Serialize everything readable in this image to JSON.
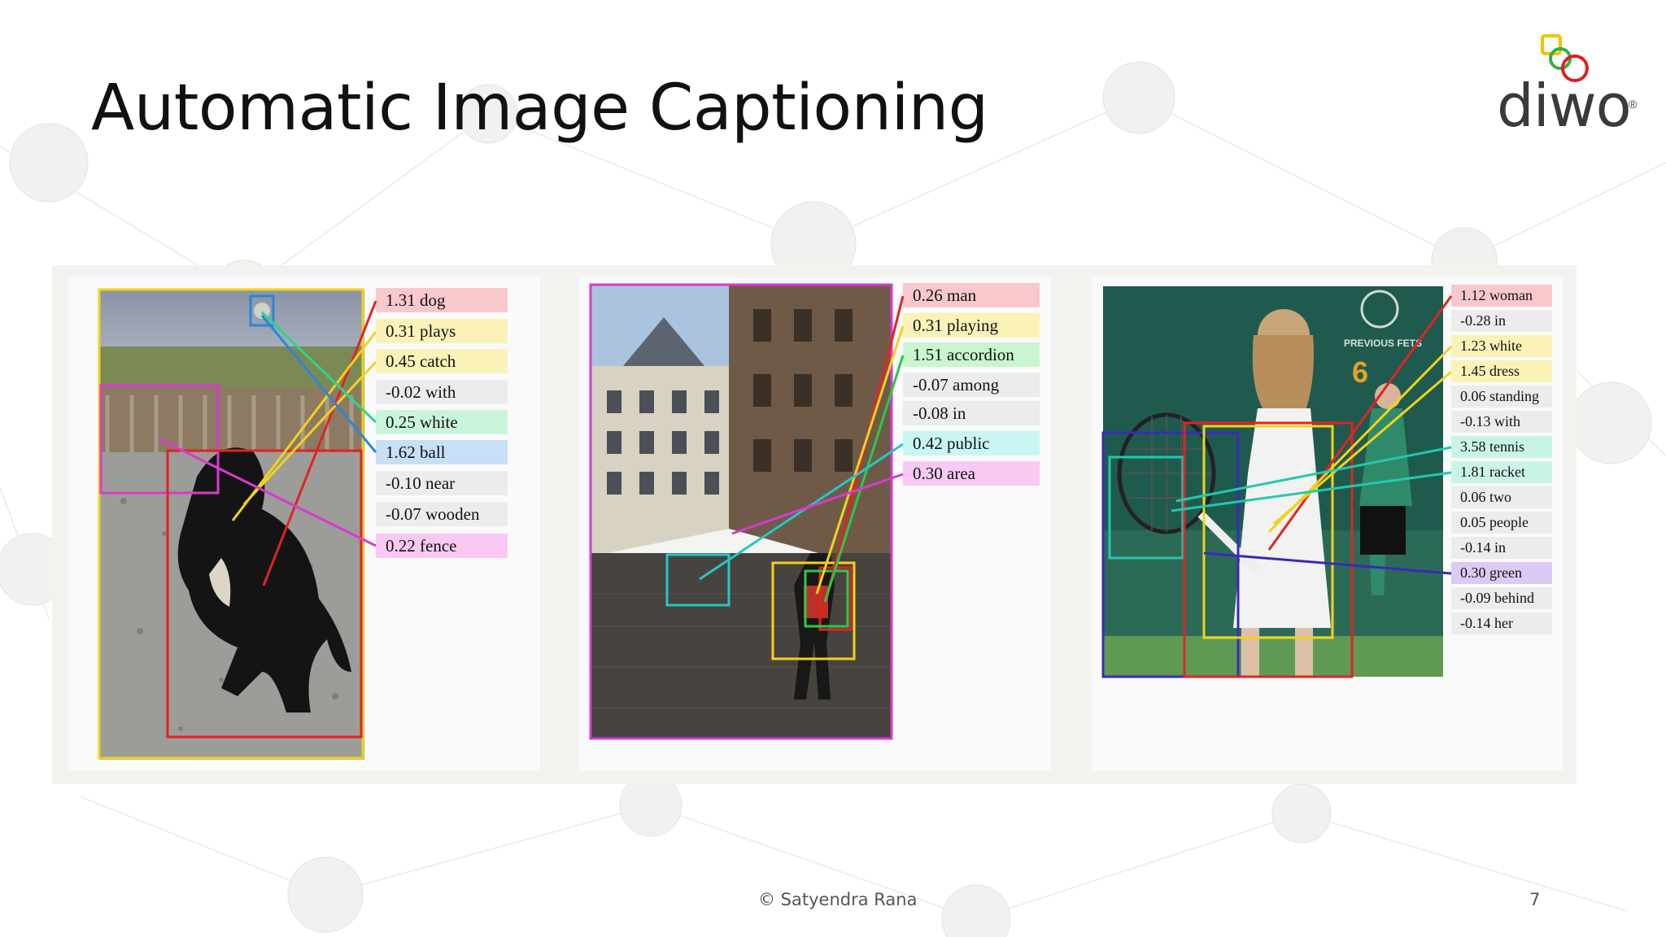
{
  "title": "Automatic Image Captioning",
  "logo": {
    "text": "diwo",
    "reg": "®",
    "rings": [
      "#f2c200",
      "#2fb34a",
      "#e02020"
    ]
  },
  "footer": {
    "copyright": "© Satyendra Rana",
    "page": "7"
  },
  "panels": [
    {
      "name": "dog",
      "labels": [
        {
          "text": "1.31 dog",
          "color": "#f9c8cc"
        },
        {
          "text": "0.31 plays",
          "color": "#fbf2b8"
        },
        {
          "text": "0.45 catch",
          "color": "#fbf2b8"
        },
        {
          "text": "-0.02 with",
          "color": "#ececec"
        },
        {
          "text": "0.25 white",
          "color": "#c9f5dc"
        },
        {
          "text": "1.62 ball",
          "color": "#c7dff7"
        },
        {
          "text": "-0.10 near",
          "color": "#ececec"
        },
        {
          "text": "-0.07 wooden",
          "color": "#ececec"
        },
        {
          "text": "0.22 fence",
          "color": "#f9c9f3"
        }
      ]
    },
    {
      "name": "street",
      "labels": [
        {
          "text": "0.26 man",
          "color": "#f9c8cc"
        },
        {
          "text": "0.31 playing",
          "color": "#fbf2b8"
        },
        {
          "text": "1.51 accordion",
          "color": "#c9f5cf"
        },
        {
          "text": "-0.07 among",
          "color": "#ececec"
        },
        {
          "text": "-0.08 in",
          "color": "#ececec"
        },
        {
          "text": "0.42 public",
          "color": "#c9f5f2"
        },
        {
          "text": "0.30 area",
          "color": "#f9c9f3"
        }
      ]
    },
    {
      "name": "tennis",
      "sign_text": "PREVIOUS FETS",
      "labels": [
        {
          "text": "1.12 woman",
          "color": "#f9c8cc"
        },
        {
          "text": "-0.28 in",
          "color": "#ececec"
        },
        {
          "text": "1.23 white",
          "color": "#fbf2b8"
        },
        {
          "text": "1.45 dress",
          "color": "#fbf2b8"
        },
        {
          "text": "0.06 standing",
          "color": "#ececec"
        },
        {
          "text": "-0.13 with",
          "color": "#ececec"
        },
        {
          "text": "3.58 tennis",
          "color": "#c9f5e4"
        },
        {
          "text": "1.81 racket",
          "color": "#c9f5e4"
        },
        {
          "text": "0.06 two",
          "color": "#ececec"
        },
        {
          "text": "0.05 people",
          "color": "#ececec"
        },
        {
          "text": "-0.14 in",
          "color": "#ececec"
        },
        {
          "text": "0.30 green",
          "color": "#dccaf5"
        },
        {
          "text": "-0.09 behind",
          "color": "#ececec"
        },
        {
          "text": "-0.14 her",
          "color": "#ececec"
        }
      ]
    }
  ]
}
